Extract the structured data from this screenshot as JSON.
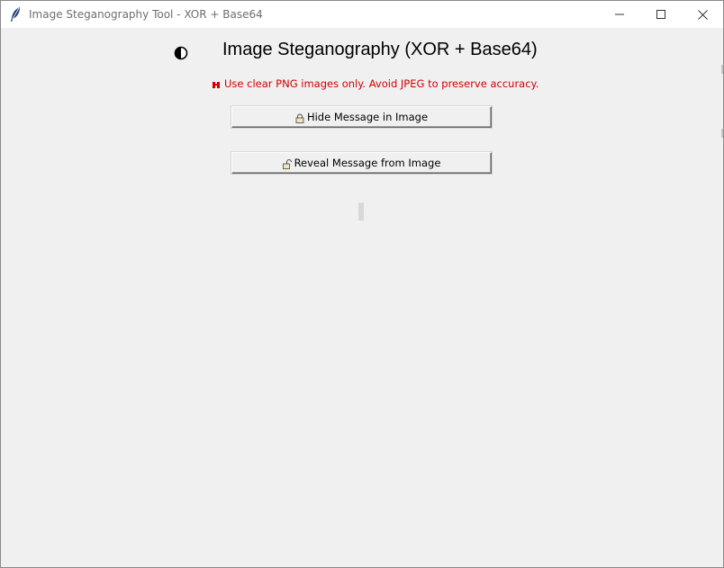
{
  "window": {
    "title": "Image Steganography Tool - XOR + Base64",
    "controls": [
      "minimize",
      "maximize",
      "close"
    ]
  },
  "header": {
    "icon": "half-shield-icon",
    "title": "Image Steganography (XOR + Base64)"
  },
  "warning": {
    "icon": "pin-icon",
    "text": "Use clear PNG images only. Avoid JPEG to preserve accuracy.",
    "color": "#d10000"
  },
  "actions": {
    "hide_label": "Hide Message in Image",
    "hide_icon": "lock-icon",
    "reveal_label": "Reveal Message from Image",
    "reveal_icon": "unlock-icon"
  },
  "colors": {
    "background": "#f0f0f0",
    "titlebar": "#ffffff",
    "warning_text": "#d10000"
  }
}
